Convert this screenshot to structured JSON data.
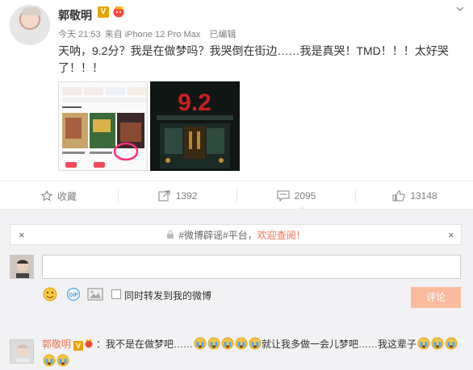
{
  "post": {
    "author": "郭敬明",
    "verified_badge": "V",
    "time": "今天 21:53",
    "source": "来自 iPhone 12 Pro Max",
    "edited": "已编辑",
    "text": "天呐，9.2分？我是在做梦吗？我哭倒在街边……我是真哭！TMD！！！太好哭了！！！",
    "pic2": {
      "score": "9.2"
    },
    "icons": [
      "chevron-down-icon",
      "vip-icon",
      "verified-icon"
    ]
  },
  "actions": {
    "favorite_label": "收藏",
    "forward_count": "1392",
    "comment_count": "2095",
    "like_count": "13148"
  },
  "notice": {
    "tag": "#微博辟谣#平台，",
    "link_text": "欢迎查阅！",
    "close": "×"
  },
  "composer": {
    "input_value": "",
    "forward_label": "同时转发到我的微博",
    "submit_label": "评论"
  },
  "comment": {
    "author": "郭敬明",
    "badge": "V",
    "sep": "：",
    "text1": "我不是在做梦吧……",
    "text2": "就让我多做一会儿梦吧……我这辈子",
    "emoji_name": "cry-emoji"
  },
  "colors": {
    "accent": "#eb7350",
    "submit_bg": "#fbbb9e",
    "vbadge": "#e8a400",
    "score": "#c8201f"
  }
}
